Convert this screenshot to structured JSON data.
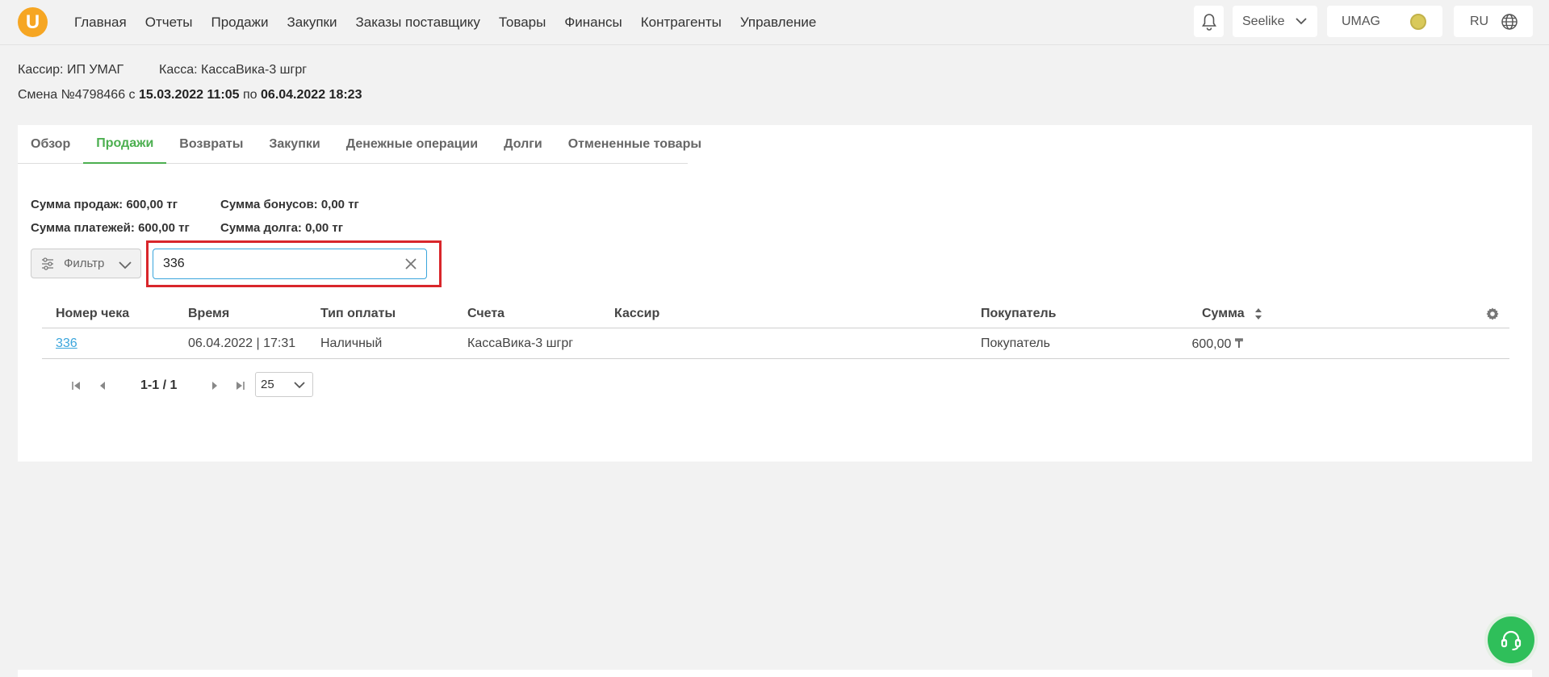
{
  "header": {
    "logo_letter": "U",
    "nav": [
      "Главная",
      "Отчеты",
      "Продажи",
      "Закупки",
      "Заказы поставщику",
      "Товары",
      "Финансы",
      "Контрагенты",
      "Управление"
    ],
    "user_name": "Seelike",
    "company": "UMAG",
    "language": "RU"
  },
  "shift": {
    "cashier_label": "Кассир: ИП УМАГ",
    "register_label": "Касса: КассаВика-3 шгрг",
    "shift_prefix": "Смена №4798466 с",
    "start": "15.03.2022 11:05",
    "by": "по",
    "end": "06.04.2022 18:23"
  },
  "tabs": [
    "Обзор",
    "Продажи",
    "Возвраты",
    "Закупки",
    "Денежные операции",
    "Долги",
    "Отмененные товары"
  ],
  "active_tab": "Продажи",
  "summary": {
    "sales": "Сумма продаж: 600,00 тг",
    "payments": "Сумма платежей: 600,00 тг",
    "bonuses": "Сумма бонусов: 0,00 тг",
    "debt": "Сумма долга: 0,00 тг"
  },
  "filter": {
    "button_label": "Фильтр",
    "search_value": "336"
  },
  "table": {
    "columns": [
      "Номер чека",
      "Время",
      "Тип оплаты",
      "Счета",
      "Кассир",
      "Покупатель",
      "Сумма"
    ],
    "rows": [
      {
        "receipt": "336",
        "time": "06.04.2022 | 17:31",
        "payment_type": "Наличный",
        "account": "КассаВика-3 шгрг",
        "cashier": "",
        "customer": "Покупатель",
        "amount": "600,00 ₸"
      }
    ]
  },
  "pagination": {
    "range": "1-1 / 1",
    "page_size": "25"
  },
  "colors": {
    "accent_green": "#4caf50",
    "link_blue": "#3aa5dc",
    "highlight_red": "#d9262b",
    "logo_orange": "#f6a623",
    "support_green": "#2fbf5a"
  }
}
